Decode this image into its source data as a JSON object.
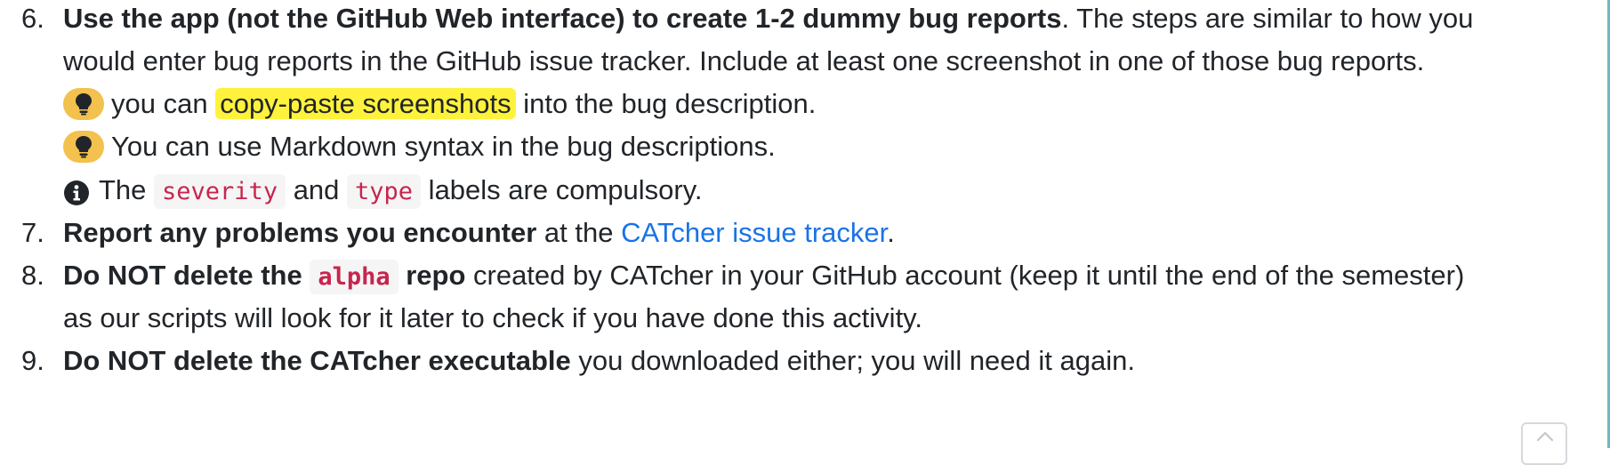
{
  "steps": [
    {
      "number": "6.",
      "bold": "Use the app (not the GitHub Web interface) to create 1-2 dummy bug reports",
      "text": ". The steps are similar to how you",
      "continuation": "would enter bug reports in the GitHub issue tracker. Include at least one screenshot in one of those bug reports.",
      "tips": [
        {
          "icon": "lightbulb-icon",
          "before": "you can ",
          "highlight": "copy-paste screenshots",
          "after": " into the bug description."
        },
        {
          "icon": "lightbulb-icon",
          "text": "You can use Markdown syntax in the bug descriptions."
        }
      ],
      "info": {
        "icon": "info-circle-icon",
        "before": "The ",
        "code1": "severity",
        "middle": " and ",
        "code2": "type",
        "after": " labels are compulsory."
      }
    },
    {
      "number": "7.",
      "bold": "Report any problems you encounter",
      "text_before_link": " at the ",
      "link": "CATcher issue tracker",
      "text_after_link": "."
    },
    {
      "number": "8.",
      "bold_before_code": "Do NOT delete the ",
      "code": "alpha",
      "bold_after_code": " repo",
      "text": " created by CATcher in your GitHub account (keep it until the end of the semester)",
      "continuation": "as our scripts will look for it later to check if you have done this activity."
    },
    {
      "number": "9.",
      "bold": "Do NOT delete the CATcher executable",
      "text": " you downloaded either; you will need it again."
    }
  ],
  "back_to_top": {
    "icon": "chevron-up-icon"
  },
  "colors": {
    "highlight": "#fff23c",
    "link": "#1a73e8",
    "code": "#c7254e",
    "tip_badge": "#f2c14e"
  }
}
